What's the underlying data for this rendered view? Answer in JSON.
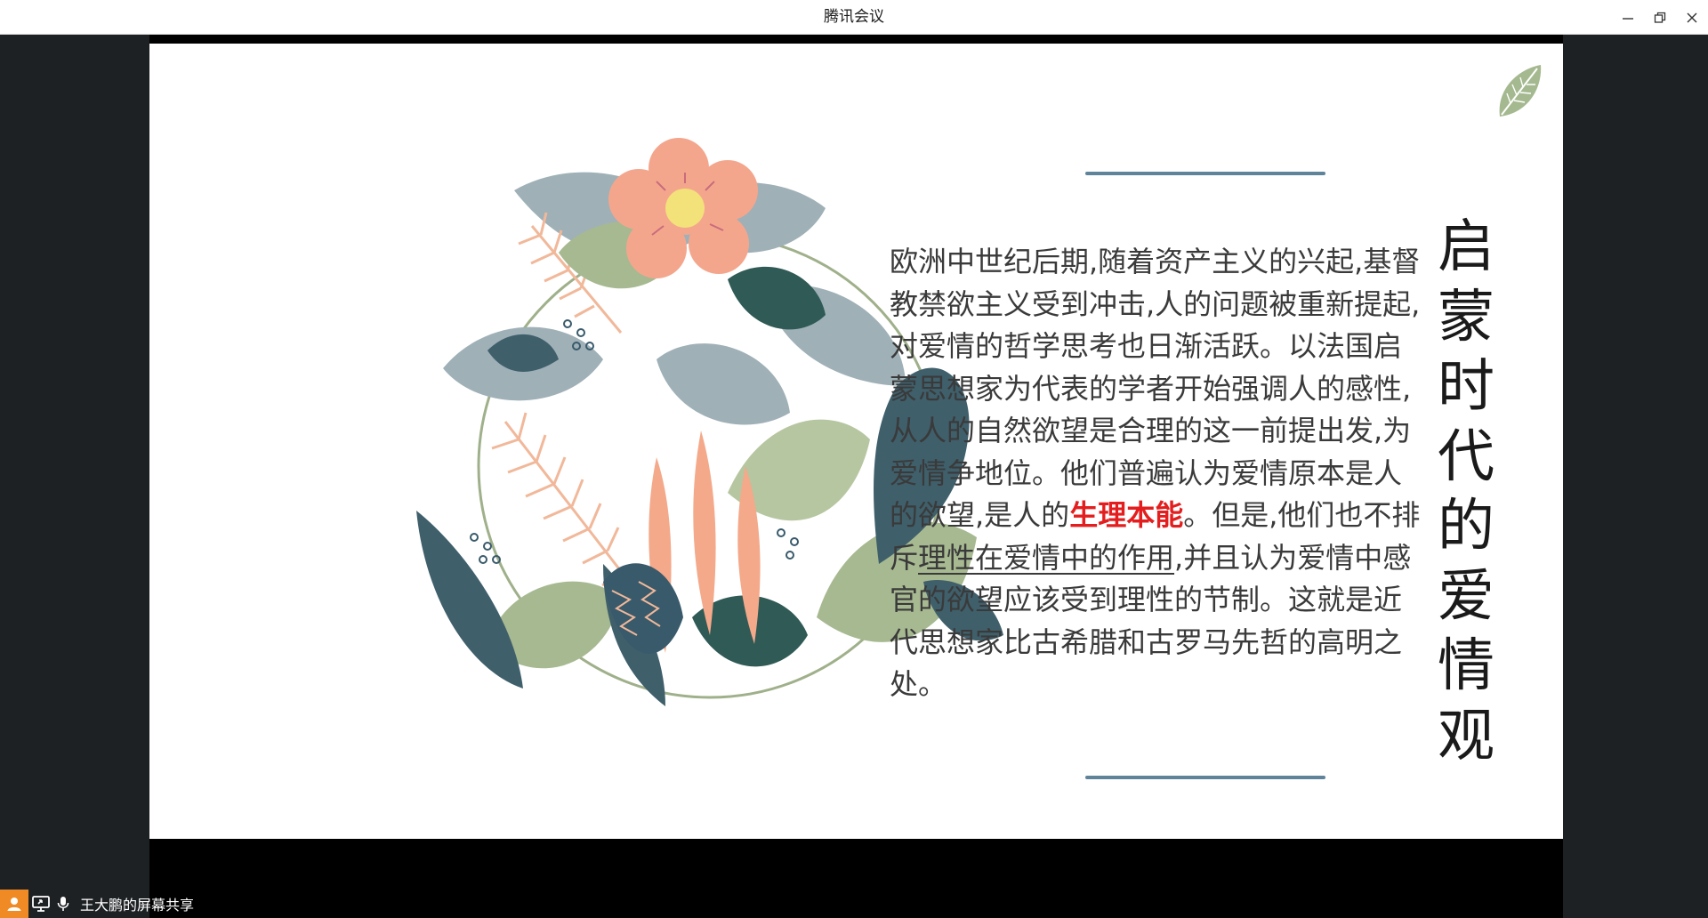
{
  "window": {
    "title": "腾讯会议"
  },
  "slide": {
    "heading_chars": [
      "启",
      "蒙",
      "时",
      "代",
      "的",
      "爱",
      "情",
      "观"
    ],
    "paragraph": {
      "part1": "欧洲中世纪后期,随着资产主义的兴起,基督教禁欲主义受到冲击,人的问题被重新提起,对爱情的哲学思考也日渐活跃。以法国启蒙思想家为代表的学者开始强调人的感性,从人的自然欲望是合理的这一前提出发,为爱情争地位。他们普遍认为爱情原本是人的欲望,是人的",
      "highlight": "生理本能",
      "part2": "。但是,他们也不排斥",
      "underlined": "理性在爱情中的作用",
      "part3": ",并且认为爱情中感官的欲望应该受到理性的节制。这就是近代思想家比古希腊和古罗马先哲的高明之处。"
    },
    "colors": {
      "accent_line": "#5f8399",
      "highlight": "#e41e1e"
    }
  },
  "statusbar": {
    "share_label": "王大鹏的屏幕共享",
    "icons": [
      "user-icon",
      "screen-share-icon",
      "microphone-icon"
    ]
  }
}
